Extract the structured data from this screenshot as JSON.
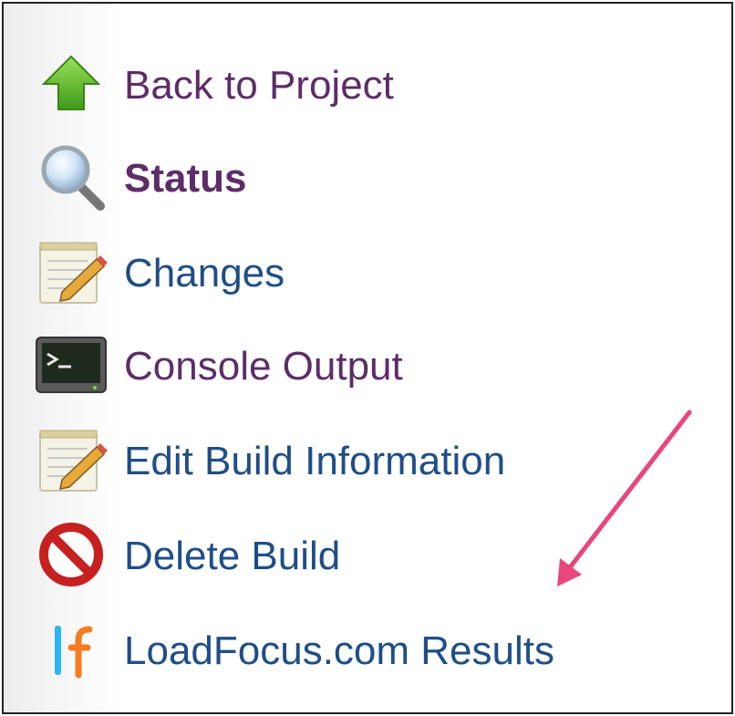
{
  "tasks": [
    {
      "label": "Back to Project",
      "icon": "green-up-arrow-icon",
      "style": "visited"
    },
    {
      "label": "Status",
      "icon": "magnifier-icon",
      "style": "visited-bold"
    },
    {
      "label": "Changes",
      "icon": "notepad-pencil-icon",
      "style": "link"
    },
    {
      "label": "Console Output",
      "icon": "terminal-icon",
      "style": "visited"
    },
    {
      "label": "Edit Build Information",
      "icon": "notepad-pencil-icon",
      "style": "link"
    },
    {
      "label": "Delete Build",
      "icon": "no-entry-icon",
      "style": "link"
    },
    {
      "label": "LoadFocus.com Results",
      "icon": "loadfocus-logo-icon",
      "style": "link"
    }
  ],
  "colors": {
    "visited_link": "#5d2d67",
    "link": "#1f4e87",
    "annotation_arrow": "#e8467c"
  }
}
